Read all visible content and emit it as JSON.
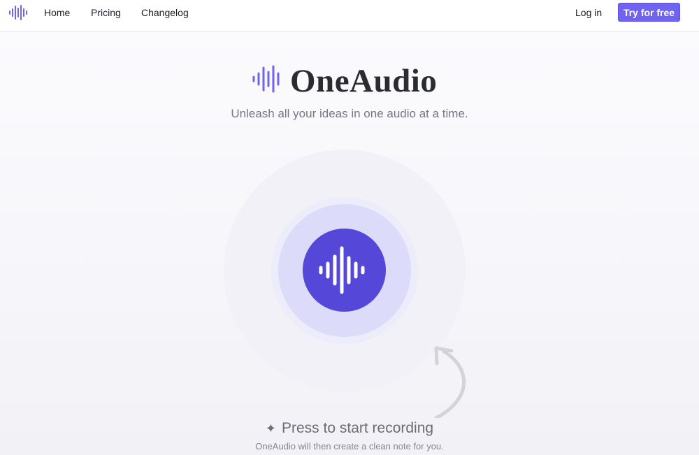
{
  "nav": {
    "links": [
      "Home",
      "Pricing",
      "Changelog"
    ],
    "login": "Log in",
    "cta": "Try for free"
  },
  "hero": {
    "brand": "OneAudio",
    "tagline": "Unleash all your ideas in one audio at a time.",
    "record_icon": "waveform-icon",
    "prompt": "Press to start recording",
    "prompt_icon": "sparkle-icon",
    "subtext": "OneAudio will then create a clean note for you."
  },
  "colors": {
    "accent": "#6f63ef",
    "record_button": "#5548d9",
    "halo": "#dcdbf9"
  }
}
